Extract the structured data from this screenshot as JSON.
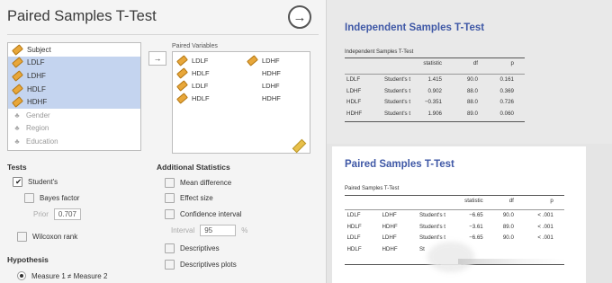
{
  "options": {
    "title": "Paired Samples T-Test",
    "run_button": "→",
    "variables": [
      {
        "name": "Subject",
        "type": "scale",
        "selected": false
      },
      {
        "name": "LDLF",
        "type": "scale",
        "selected": true
      },
      {
        "name": "LDHF",
        "type": "scale",
        "selected": true
      },
      {
        "name": "HDLF",
        "type": "scale",
        "selected": true
      },
      {
        "name": "HDHF",
        "type": "scale",
        "selected": true
      },
      {
        "name": "Gender",
        "type": "nominal",
        "selected": false
      },
      {
        "name": "Region",
        "type": "nominal",
        "selected": false
      },
      {
        "name": "Education",
        "type": "nominal",
        "selected": false
      }
    ],
    "move_button": "→",
    "paired_label": "Paired Variables",
    "pairs": [
      [
        "LDLF",
        "LDHF"
      ],
      [
        "HDLF",
        "HDHF"
      ],
      [
        "LDLF",
        "LDHF"
      ],
      [
        "HDLF",
        "HDHF"
      ]
    ],
    "tests": {
      "heading": "Tests",
      "students": "Student's",
      "bayes": "Bayes factor",
      "prior_label": "Prior",
      "prior_value": "0.707",
      "wilcoxon": "Wilcoxon rank"
    },
    "additional": {
      "heading": "Additional Statistics",
      "mean_difference": "Mean difference",
      "effect_size": "Effect size",
      "confidence_interval": "Confidence interval",
      "interval_label": "Interval",
      "interval_value": "95",
      "interval_unit": "%",
      "descriptives": "Descriptives",
      "descriptives_plots": "Descriptives plots"
    },
    "hypothesis": {
      "heading": "Hypothesis",
      "option1": "Measure 1 ≠ Measure 2"
    }
  },
  "results": {
    "independent": {
      "title": "Independent Samples T-Test",
      "caption": "Independent Samples T-Test",
      "headers": [
        "",
        "",
        "statistic",
        "df",
        "p"
      ],
      "rows": [
        [
          "LDLF",
          "Student's t",
          "1.415",
          "90.0",
          "0.161"
        ],
        [
          "LDHF",
          "Student's t",
          "0.902",
          "88.0",
          "0.369"
        ],
        [
          "HDLF",
          "Student's t",
          "−0.351",
          "88.0",
          "0.726"
        ],
        [
          "HDHF",
          "Student's t",
          "1.906",
          "89.0",
          "0.060"
        ]
      ]
    },
    "paired": {
      "title": "Paired Samples T-Test",
      "caption": "Paired Samples T-Test",
      "headers": [
        "",
        "",
        "",
        "statistic",
        "df",
        "p"
      ],
      "rows": [
        [
          "LDLF",
          "LDHF",
          "Student's t",
          "−6.65",
          "90.0",
          "< .001"
        ],
        [
          "HDLF",
          "HDHF",
          "Student's t",
          "−3.61",
          "89.0",
          "< .001"
        ],
        [
          "LDLF",
          "LDHF",
          "Student's t",
          "−6.65",
          "90.0",
          "< .001"
        ],
        [
          "HDLF",
          "HDHF",
          "St",
          "",
          "",
          ""
        ]
      ]
    }
  },
  "icons": {
    "scale": "ruler-icon",
    "nominal": "nominal-icon",
    "run": "arrow-right-circle-icon",
    "pencil": "pencil-icon"
  },
  "colors": {
    "accent": "#3f58a6",
    "selection": "#c4d4ef",
    "panel": "#f4f4f4",
    "results_bg": "#e5e5e5"
  }
}
